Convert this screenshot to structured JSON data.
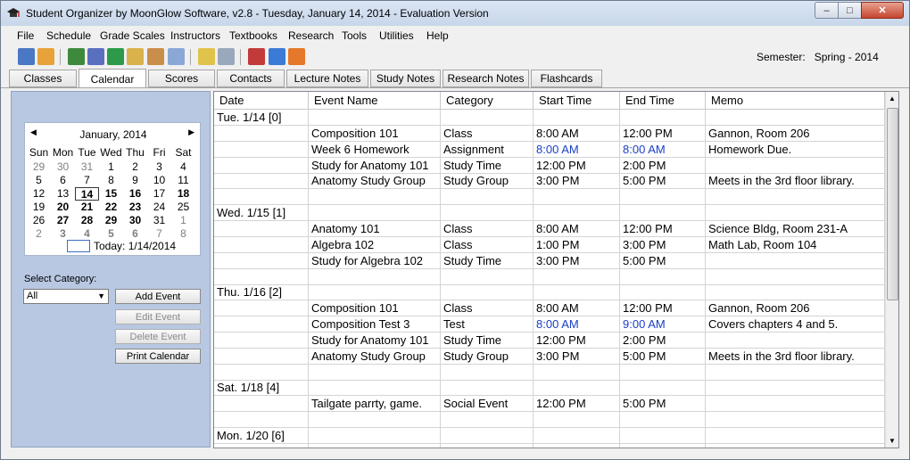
{
  "window": {
    "title": "Student Organizer by MoonGlow Software, v2.8  -  Tuesday, January 14, 2014  -  Evaluation Version",
    "min_label": "–",
    "max_label": "□",
    "close_label": "✕"
  },
  "menu": [
    "File",
    "Schedule",
    "Grade Scales",
    "Instructors",
    "Textbooks",
    "Research",
    "Tools",
    "Utilities",
    "Help"
  ],
  "toolbar_icons": [
    "classes-icon",
    "schedule-icon",
    "grades-icon",
    "notes-icon",
    "books-icon",
    "calendar-icon",
    "planner-icon",
    "alarm-icon",
    "edit-icon",
    "search-doc-icon",
    "tools-icon",
    "help-book-icon",
    "exit-icon"
  ],
  "semester": {
    "label": "Semester:",
    "value": "Spring - 2014"
  },
  "tabs": [
    "Classes",
    "Calendar",
    "Scores",
    "Contacts",
    "Lecture Notes",
    "Study Notes",
    "Research Notes",
    "Flashcards"
  ],
  "active_tab": "Calendar",
  "calendar": {
    "month": "January, 2014",
    "prev": "◀",
    "next": "▶",
    "dow": [
      "Sun",
      "Mon",
      "Tue",
      "Wed",
      "Thu",
      "Fri",
      "Sat"
    ],
    "weeks": [
      [
        [
          "29",
          "o"
        ],
        [
          "30",
          "o"
        ],
        [
          "31",
          "o"
        ],
        [
          "1",
          ""
        ],
        [
          "2",
          ""
        ],
        [
          "3",
          ""
        ],
        [
          "4",
          ""
        ]
      ],
      [
        [
          "5",
          ""
        ],
        [
          "6",
          ""
        ],
        [
          "7",
          ""
        ],
        [
          "8",
          ""
        ],
        [
          "9",
          ""
        ],
        [
          "10",
          ""
        ],
        [
          "11",
          ""
        ]
      ],
      [
        [
          "12",
          ""
        ],
        [
          "13",
          ""
        ],
        [
          "14",
          "t"
        ],
        [
          "15",
          "b"
        ],
        [
          "16",
          "b"
        ],
        [
          "17",
          ""
        ],
        [
          "18",
          "b"
        ]
      ],
      [
        [
          "19",
          ""
        ],
        [
          "20",
          "b"
        ],
        [
          "21",
          "b"
        ],
        [
          "22",
          "b"
        ],
        [
          "23",
          "b"
        ],
        [
          "24",
          ""
        ],
        [
          "25",
          ""
        ]
      ],
      [
        [
          "26",
          ""
        ],
        [
          "27",
          "b"
        ],
        [
          "28",
          "b"
        ],
        [
          "29",
          "b"
        ],
        [
          "30",
          "b"
        ],
        [
          "31",
          ""
        ],
        [
          "1",
          "o"
        ]
      ],
      [
        [
          "2",
          "o"
        ],
        [
          "3",
          "ob"
        ],
        [
          "4",
          "ob"
        ],
        [
          "5",
          "ob"
        ],
        [
          "6",
          "ob"
        ],
        [
          "7",
          "o"
        ],
        [
          "8",
          "o"
        ]
      ]
    ],
    "today_label": "Today: 1/14/2014"
  },
  "category": {
    "label": "Select Category:",
    "value": "All"
  },
  "buttons": {
    "add": "Add Event",
    "edit": "Edit Event",
    "delete": "Delete Event",
    "print": "Print Calendar"
  },
  "grid": {
    "headers": [
      "Date",
      "Event Name",
      "Category",
      "Start Time",
      "End Time",
      "Memo"
    ],
    "rows": [
      {
        "date": "Tue. 1/14  [0]",
        "name": "",
        "category": "",
        "start": "",
        "end": "",
        "memo": ""
      },
      {
        "date": "",
        "name": "Composition 101",
        "category": "Class",
        "start": "8:00 AM",
        "end": "12:00 PM",
        "memo": "Gannon,  Room 206"
      },
      {
        "date": "",
        "name": "Week 6 Homework",
        "category": "Assignment",
        "start": "8:00 AM",
        "end": "8:00 AM",
        "memo": "Homework Due.",
        "blue": true
      },
      {
        "date": "",
        "name": "Study for Anatomy 101",
        "category": "Study Time",
        "start": "12:00 PM",
        "end": "2:00 PM",
        "memo": ""
      },
      {
        "date": "",
        "name": "Anatomy Study Group",
        "category": "Study Group",
        "start": "3:00 PM",
        "end": "5:00 PM",
        "memo": "Meets in the 3rd floor library."
      },
      {
        "date": "",
        "name": "",
        "category": "",
        "start": "",
        "end": "",
        "memo": ""
      },
      {
        "date": "Wed. 1/15  [1]",
        "name": "",
        "category": "",
        "start": "",
        "end": "",
        "memo": ""
      },
      {
        "date": "",
        "name": "Anatomy 101",
        "category": "Class",
        "start": "8:00 AM",
        "end": "12:00 PM",
        "memo": "Science Bldg,  Room 231-A"
      },
      {
        "date": "",
        "name": "Algebra 102",
        "category": "Class",
        "start": "1:00 PM",
        "end": "3:00 PM",
        "memo": "Math Lab,  Room 104"
      },
      {
        "date": "",
        "name": "Study for Algebra 102",
        "category": "Study Time",
        "start": "3:00 PM",
        "end": "5:00 PM",
        "memo": ""
      },
      {
        "date": "",
        "name": "",
        "category": "",
        "start": "",
        "end": "",
        "memo": ""
      },
      {
        "date": "Thu. 1/16  [2]",
        "name": "",
        "category": "",
        "start": "",
        "end": "",
        "memo": ""
      },
      {
        "date": "",
        "name": "Composition 101",
        "category": "Class",
        "start": "8:00 AM",
        "end": "12:00 PM",
        "memo": "Gannon,  Room 206"
      },
      {
        "date": "",
        "name": "Composition Test 3",
        "category": "Test",
        "start": "8:00 AM",
        "end": "9:00 AM",
        "memo": "Covers chapters 4 and 5.",
        "blue": true
      },
      {
        "date": "",
        "name": "Study for Anatomy 101",
        "category": "Study Time",
        "start": "12:00 PM",
        "end": "2:00 PM",
        "memo": ""
      },
      {
        "date": "",
        "name": "Anatomy Study Group",
        "category": "Study Group",
        "start": "3:00 PM",
        "end": "5:00 PM",
        "memo": "Meets in the 3rd floor library."
      },
      {
        "date": "",
        "name": "",
        "category": "",
        "start": "",
        "end": "",
        "memo": ""
      },
      {
        "date": "Sat. 1/18  [4]",
        "name": "",
        "category": "",
        "start": "",
        "end": "",
        "memo": ""
      },
      {
        "date": "",
        "name": "Tailgate parrty, game.",
        "category": "Social Event",
        "start": "12:00 PM",
        "end": "5:00 PM",
        "memo": ""
      },
      {
        "date": "",
        "name": "",
        "category": "",
        "start": "",
        "end": "",
        "memo": ""
      },
      {
        "date": "Mon. 1/20  [6]",
        "name": "",
        "category": "",
        "start": "",
        "end": "",
        "memo": ""
      },
      {
        "date": "",
        "name": "",
        "category": "",
        "start": "",
        "end": "",
        "memo": ""
      }
    ]
  },
  "colors": {
    "accent_blue": "#1a3fc4",
    "panel": "#b8c8e2"
  }
}
